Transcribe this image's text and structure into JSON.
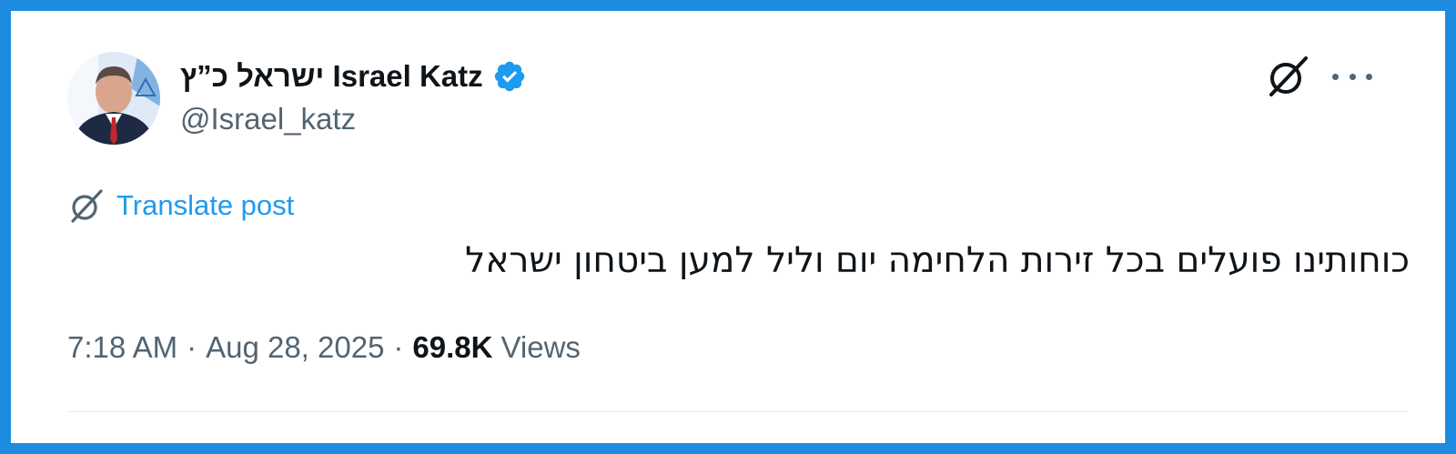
{
  "post": {
    "author_name": "ישראל כ”ץ Israel Katz",
    "handle": "@Israel_katz",
    "translate_label": "Translate post",
    "text": "כוחותינו פועלים בכל זירות הלחימה יום וליל למען ביטחון ישראל",
    "time": "7:18 AM",
    "date": "Aug 28, 2025",
    "views_count": "69.8K",
    "views_label": "Views",
    "separator": "·"
  },
  "icons": {
    "verified": "verified-badge-icon",
    "brand": "grok-logo-icon",
    "more": "more-horizontal-icon",
    "translate": "translate-icon"
  },
  "colors": {
    "border": "#1d8ce0",
    "accent": "#1d9bf0",
    "text_primary": "#0f1419",
    "text_secondary": "#536471"
  }
}
